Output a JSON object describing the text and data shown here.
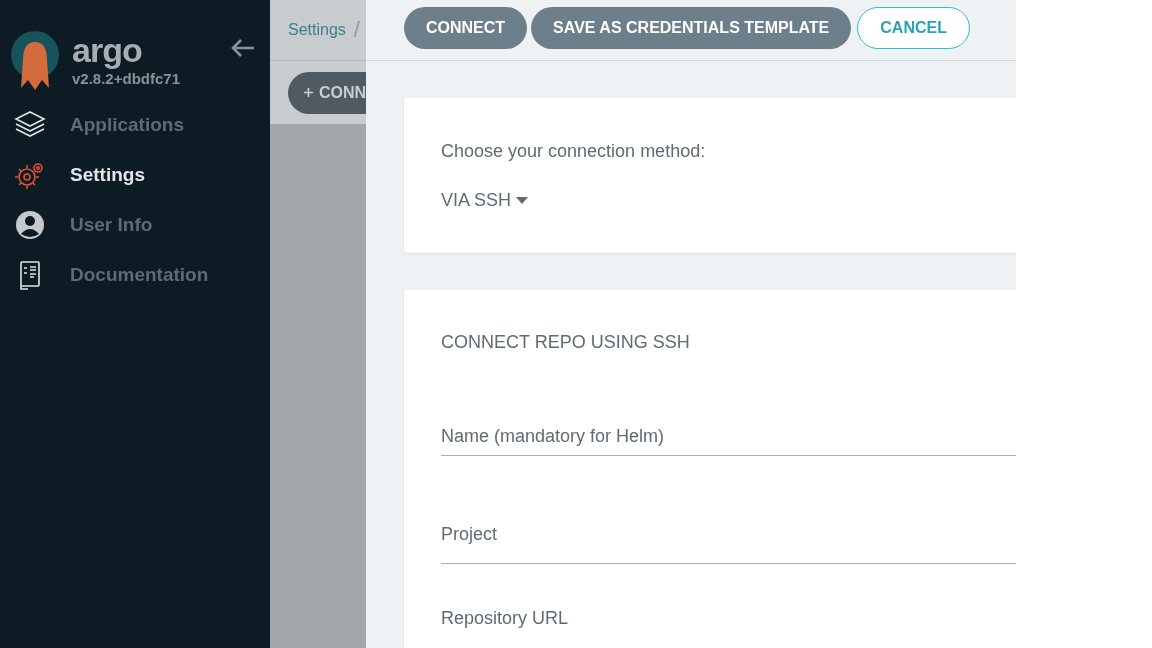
{
  "sidebar": {
    "brand": "argo",
    "version": "v2.8.2+dbdfc71",
    "items": [
      {
        "label": "Applications",
        "kind": "layers",
        "selected": false
      },
      {
        "label": "Settings",
        "kind": "gear",
        "selected": true
      },
      {
        "label": "User Info",
        "kind": "user",
        "selected": false
      },
      {
        "label": "Documentation",
        "kind": "book",
        "selected": false
      }
    ]
  },
  "background_page": {
    "breadcrumb": [
      "Settings",
      "/"
    ],
    "button": "CONN"
  },
  "panel": {
    "buttons": [
      {
        "label": "CONNECT",
        "kind": "filled"
      },
      {
        "label": "SAVE AS CREDENTIALS TEMPLATE",
        "kind": "filled"
      },
      {
        "label": "CANCEL",
        "kind": "outline"
      }
    ],
    "method_card": {
      "prompt": "Choose your connection method:",
      "method": "VIA SSH"
    },
    "form": {
      "title": "CONNECT REPO USING SSH",
      "fields": [
        {
          "placeholder": "Name (mandatory for Helm)"
        },
        {
          "placeholder": "Project"
        },
        {
          "placeholder": "Repository URL"
        }
      ]
    }
  }
}
